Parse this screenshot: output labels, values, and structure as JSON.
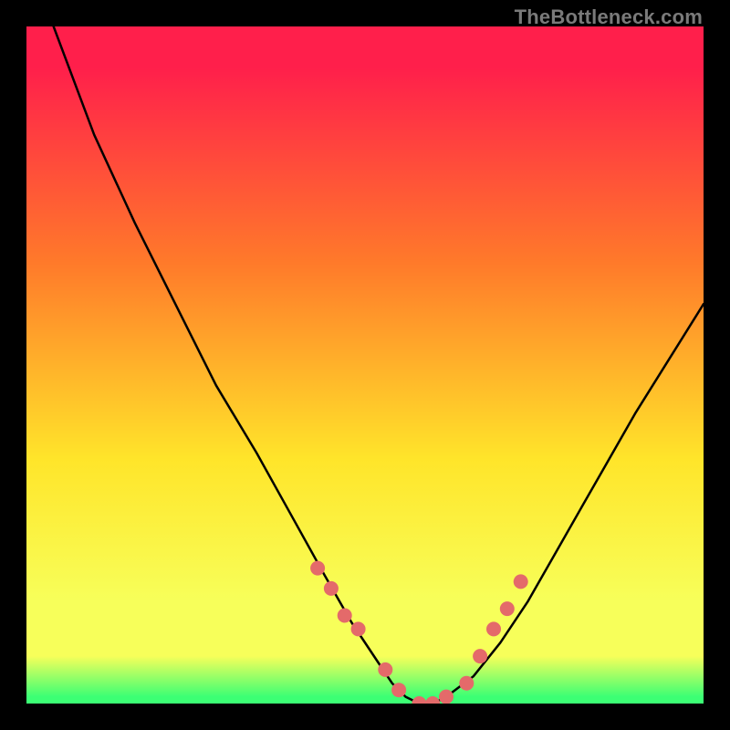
{
  "watermark": {
    "text": "TheBottleneck.com"
  },
  "colors": {
    "background": "#000000",
    "gradient_top": "#ff1f4b",
    "gradient_upper_mid": "#ff7a2a",
    "gradient_mid": "#ffe52a",
    "gradient_lower": "#f7ff5a",
    "gradient_bottom": "#3cff74",
    "curve_stroke": "#000000",
    "marker_fill": "#e46a6a"
  },
  "chart_data": {
    "type": "line",
    "title": "",
    "xlabel": "",
    "ylabel": "",
    "xlim": [
      0,
      100
    ],
    "ylim": [
      0,
      100
    ],
    "grid": false,
    "legend": false,
    "series": [
      {
        "name": "bottleneck-curve",
        "x": [
          0,
          4,
          10,
          16,
          22,
          28,
          34,
          39,
          44,
          48,
          52,
          54,
          56,
          58,
          60,
          62,
          66,
          70,
          74,
          78,
          82,
          86,
          90,
          95,
          100
        ],
        "values": [
          140,
          100,
          84,
          71,
          59,
          47,
          37,
          28,
          19,
          12,
          6,
          3,
          1,
          0,
          0,
          1,
          4,
          9,
          15,
          22,
          29,
          36,
          43,
          51,
          59
        ]
      }
    ],
    "markers": {
      "name": "highlighted-points",
      "x": [
        43,
        45,
        47,
        49,
        53,
        55,
        58,
        60,
        62,
        65,
        67,
        69,
        71,
        73
      ],
      "values": [
        20,
        17,
        13,
        11,
        5,
        2,
        0,
        0,
        1,
        3,
        7,
        11,
        14,
        18
      ]
    }
  }
}
